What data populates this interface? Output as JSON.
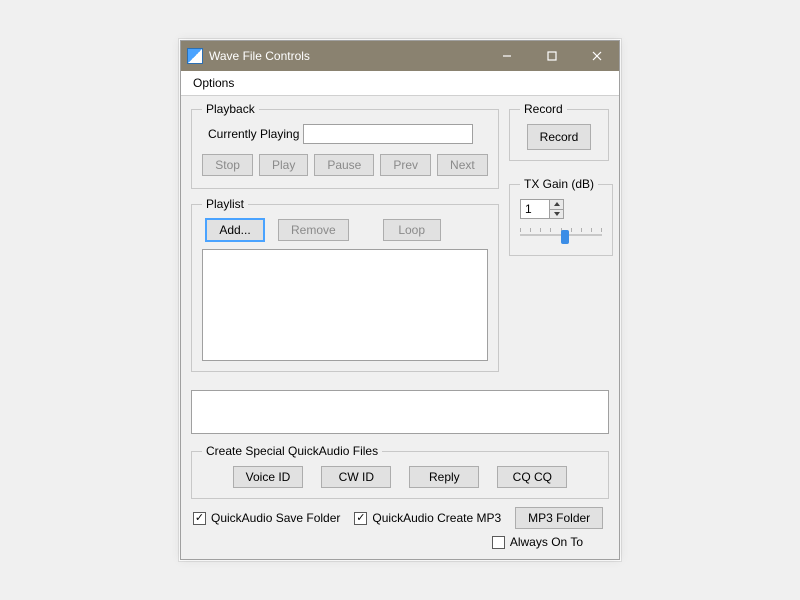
{
  "window": {
    "title": "Wave File Controls"
  },
  "menu": {
    "options": "Options"
  },
  "playback": {
    "legend": "Playback",
    "currently_playing_label": "Currently Playing",
    "currently_playing_value": "",
    "buttons": {
      "stop": "Stop",
      "play": "Play",
      "pause": "Pause",
      "prev": "Prev",
      "next": "Next"
    }
  },
  "record": {
    "legend": "Record",
    "button": "Record"
  },
  "tx_gain": {
    "legend": "TX Gain (dB)",
    "value": "1",
    "slider_percent": 55
  },
  "playlist": {
    "legend": "Playlist",
    "buttons": {
      "add": "Add...",
      "remove": "Remove",
      "loop": "Loop"
    },
    "items": []
  },
  "status_text": "",
  "special": {
    "legend": "Create Special QuickAudio Files",
    "buttons": {
      "voice_id": "Voice ID",
      "cw_id": "CW ID",
      "reply": "Reply",
      "cq_cq": "CQ CQ"
    }
  },
  "checks": {
    "save_folder": {
      "label": "QuickAudio Save Folder",
      "checked": true
    },
    "create_mp3": {
      "label": "QuickAudio Create MP3",
      "checked": true
    },
    "mp3_folder_button": "MP3 Folder",
    "always_on_top": {
      "label": "Always On To",
      "checked": false
    }
  }
}
